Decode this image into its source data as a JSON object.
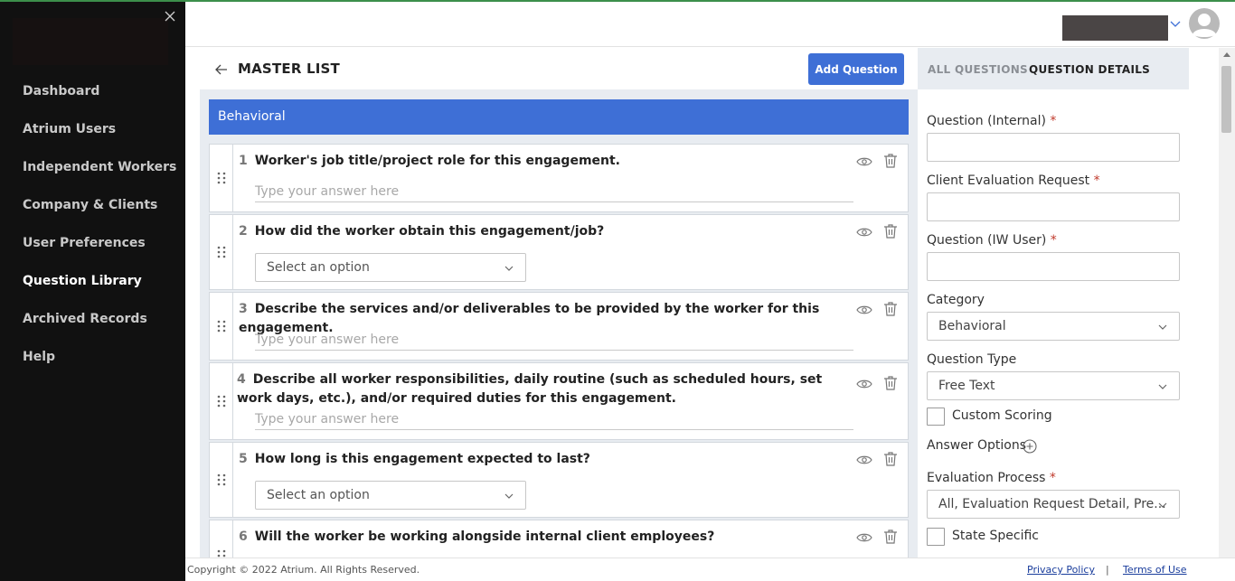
{
  "sidebar": {
    "items": [
      {
        "label": "Dashboard"
      },
      {
        "label": "Atrium Users"
      },
      {
        "label": "Independent Workers"
      },
      {
        "label": "Company & Clients"
      },
      {
        "label": "User Preferences"
      },
      {
        "label": "Question Library",
        "active": true
      },
      {
        "label": "Archived Records"
      },
      {
        "label": "Help"
      }
    ]
  },
  "main": {
    "title": "MASTER LIST",
    "add_button": "Add Question",
    "category": "Behavioral",
    "questions": [
      {
        "num": "1",
        "text": "Worker's job title/project role for this engagement.",
        "answer_type": "text",
        "placeholder": "Type your answer here"
      },
      {
        "num": "2",
        "text": "How did the worker obtain this engagement/job?",
        "answer_type": "select",
        "placeholder": "Select an option"
      },
      {
        "num": "3",
        "text": "Describe the services and/or deliverables to be provided by the worker for this engagement.",
        "answer_type": "text",
        "placeholder": "Type your answer here"
      },
      {
        "num": "4",
        "text": "Describe all worker responsibilities, daily routine (such as scheduled hours, set work days, etc.), and/or required duties for this engagement.",
        "answer_type": "text",
        "placeholder": "Type your answer here"
      },
      {
        "num": "5",
        "text": "How long is this engagement expected to last?",
        "answer_type": "select",
        "placeholder": "Select an option"
      },
      {
        "num": "6",
        "text": "Will the worker be working alongside internal client employees?",
        "answer_type": "none",
        "placeholder": ""
      }
    ]
  },
  "details": {
    "tab_all": "ALL QUESTIONS",
    "tab_details": "QUESTION DETAILS",
    "question_internal_label": "Question (Internal)",
    "client_eval_label": "Client Evaluation Request",
    "question_iw_label": "Question (IW User)",
    "required_mark": "*",
    "category_label": "Category",
    "category_value": "Behavioral",
    "question_type_label": "Question Type",
    "question_type_value": "Free Text",
    "custom_scoring_label": "Custom Scoring",
    "answer_options_label": "Answer Options",
    "evaluation_process_label": "Evaluation Process",
    "evaluation_process_value": "All, Evaluation Request Detail, Pre...",
    "state_specific_label": "State Specific"
  },
  "footer": {
    "copyright": "Copyright © 2022 Atrium. All Rights Reserved.",
    "privacy": "Privacy Policy",
    "separator": "|",
    "terms": "Terms of Use"
  },
  "colors": {
    "sidebar_bg": "#111111",
    "accent": "#3e6fd6",
    "panel_bg": "#e8ecf1",
    "required": "#c0392b"
  }
}
